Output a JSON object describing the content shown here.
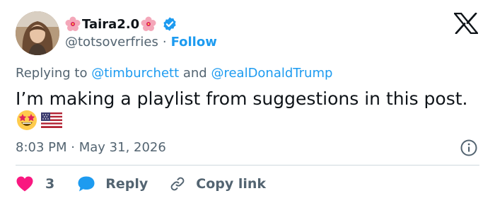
{
  "author": {
    "display_name": "Taira2.0",
    "handle": "@totsoverfries",
    "separator": "·",
    "follow_label": "Follow"
  },
  "reply_context": {
    "prefix": "Replying to ",
    "mention_1": "@timburchett",
    "conjunction": " and ",
    "mention_2": "@realDonaldTrump"
  },
  "tweet": {
    "text": "I’m making a playlist from suggestions in this post."
  },
  "meta": {
    "time": "8:03 PM",
    "separator": "·",
    "date": "May 31, 2026"
  },
  "actions": {
    "like_count": "3",
    "reply_label": "Reply",
    "copy_label": "Copy link"
  },
  "icons": {
    "flower": "hibiscus-icon",
    "verified": "verified-badge-icon",
    "logo": "x-logo-icon",
    "info": "info-icon",
    "like": "heart-icon",
    "reply": "reply-bubble-icon",
    "copy": "link-icon",
    "emoji_1": "star-struck-emoji",
    "emoji_2": "us-flag-emoji"
  },
  "colors": {
    "accent": "#1d9bf0",
    "like": "#f91880",
    "secondary_text": "#536471",
    "primary_text": "#0f1419"
  }
}
